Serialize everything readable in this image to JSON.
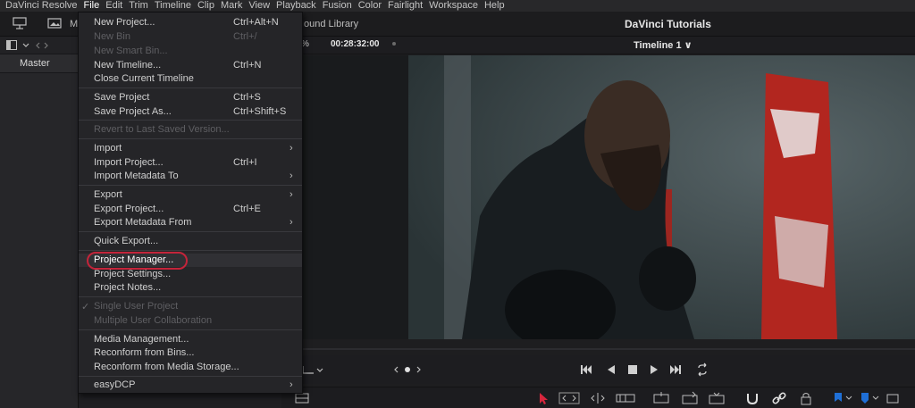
{
  "menubar": {
    "items": [
      "DaVinci Resolve",
      "File",
      "Edit",
      "Trim",
      "Timeline",
      "Clip",
      "Mark",
      "View",
      "Playback",
      "Fusion",
      "Color",
      "Fairlight",
      "Workspace",
      "Help"
    ],
    "active": "File"
  },
  "toolbar": {
    "media_pool_initial": "M",
    "sound_library": "ound Library",
    "project_title": "DaVinci Tutorials"
  },
  "left_panel": {
    "master_label": "Master"
  },
  "viewer": {
    "zoom": "%",
    "timecode": "00:28:32:00",
    "timeline_name": "Timeline 1 ∨"
  },
  "file_menu": {
    "items": [
      {
        "label": "New Project...",
        "shortcut": "Ctrl+Alt+N",
        "enabled": true,
        "submenu": false
      },
      {
        "label": "New Bin",
        "shortcut": "Ctrl+/",
        "enabled": false,
        "submenu": false
      },
      {
        "label": "New Smart Bin...",
        "shortcut": "",
        "enabled": false,
        "submenu": false
      },
      {
        "label": "New Timeline...",
        "shortcut": "Ctrl+N",
        "enabled": true,
        "submenu": false
      },
      {
        "label": "Close Current Timeline",
        "shortcut": "",
        "enabled": true,
        "submenu": false
      },
      {
        "label": "Save Project",
        "shortcut": "Ctrl+S",
        "enabled": true,
        "submenu": false
      },
      {
        "label": "Save Project As...",
        "shortcut": "Ctrl+Shift+S",
        "enabled": true,
        "submenu": false
      },
      {
        "label": "Revert to Last Saved Version...",
        "shortcut": "",
        "enabled": false,
        "submenu": false
      },
      {
        "label": "Import",
        "shortcut": "",
        "enabled": true,
        "submenu": true
      },
      {
        "label": "Import Project...",
        "shortcut": "Ctrl+I",
        "enabled": true,
        "submenu": false
      },
      {
        "label": "Import Metadata To",
        "shortcut": "",
        "enabled": true,
        "submenu": true
      },
      {
        "label": "Export",
        "shortcut": "",
        "enabled": true,
        "submenu": true
      },
      {
        "label": "Export Project...",
        "shortcut": "Ctrl+E",
        "enabled": true,
        "submenu": false
      },
      {
        "label": "Export Metadata From",
        "shortcut": "",
        "enabled": true,
        "submenu": true
      },
      {
        "label": "Quick Export...",
        "shortcut": "",
        "enabled": true,
        "submenu": false
      },
      {
        "label": "Project Manager...",
        "shortcut": "",
        "enabled": true,
        "submenu": false
      },
      {
        "label": "Project Settings...",
        "shortcut": "",
        "enabled": true,
        "submenu": false
      },
      {
        "label": "Project Notes...",
        "shortcut": "",
        "enabled": true,
        "submenu": false
      },
      {
        "label": "Single User Project",
        "shortcut": "",
        "enabled": false,
        "submenu": false,
        "checked": true
      },
      {
        "label": "Multiple User Collaboration",
        "shortcut": "",
        "enabled": false,
        "submenu": false
      },
      {
        "label": "Media Management...",
        "shortcut": "",
        "enabled": true,
        "submenu": false
      },
      {
        "label": "Reconform from Bins...",
        "shortcut": "",
        "enabled": true,
        "submenu": false
      },
      {
        "label": "Reconform from Media Storage...",
        "shortcut": "",
        "enabled": true,
        "submenu": false
      },
      {
        "label": "easyDCP",
        "shortcut": "",
        "enabled": true,
        "submenu": true
      }
    ],
    "highlighted": "Project Manager..."
  },
  "colors": {
    "accent_red": "#c4243a",
    "flag_blue": "#1f6fd6",
    "cursor_red": "#d7263d"
  },
  "icons": {
    "submenu_arrow": "›",
    "check": "✓"
  }
}
